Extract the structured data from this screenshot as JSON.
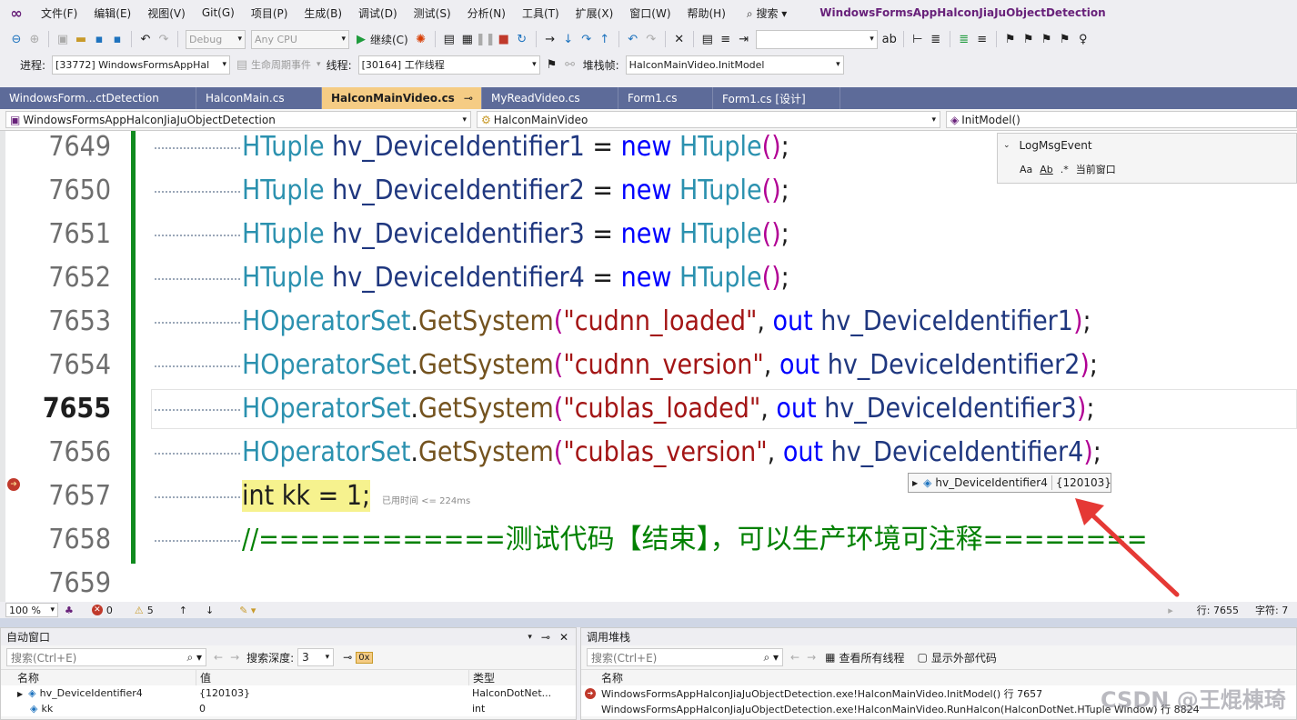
{
  "menubar": {
    "logo": "VS",
    "items": [
      "文件(F)",
      "编辑(E)",
      "视图(V)",
      "Git(G)",
      "项目(P)",
      "生成(B)",
      "调试(D)",
      "测试(S)",
      "分析(N)",
      "工具(T)",
      "扩展(X)",
      "窗口(W)",
      "帮助(H)"
    ],
    "search": "搜索",
    "title": "WindowsFormsAppHalconJiaJuObjectDetection"
  },
  "toolbar1": {
    "config": "Debug",
    "platform": "Any CPU",
    "continue": "继续(C)"
  },
  "toolbar2": {
    "process_label": "进程:",
    "process_value": "[33772] WindowsFormsAppHal",
    "lifecycle": "生命周期事件",
    "thread_label": "线程:",
    "thread_value": "[30164] 工作线程",
    "stackframe_label": "堆栈帧:",
    "stackframe_value": "HalconMainVideo.InitModel"
  },
  "tabs": [
    "WindowsForm...ctDetection",
    "HalconMain.cs",
    "HalconMainVideo.cs",
    "MyReadVideo.cs",
    "Form1.cs",
    "Form1.cs [设计]"
  ],
  "navbar": {
    "project": "WindowsFormsAppHalconJiaJuObjectDetection",
    "class": "HalconMainVideo",
    "member": "InitModel()"
  },
  "editor": {
    "lines": [
      "7649",
      "7650",
      "7651",
      "7652",
      "7653",
      "7654",
      "7655",
      "7656",
      "7657",
      "7658",
      "7659"
    ],
    "current_line": "7655",
    "code": {
      "l7649": [
        "HTuple",
        "hv_DeviceIdentifier1",
        "=",
        "new",
        "HTuple",
        "()",
        ";"
      ],
      "l7650": [
        "HTuple",
        "hv_DeviceIdentifier2",
        "=",
        "new",
        "HTuple",
        "()",
        ";"
      ],
      "l7651": [
        "HTuple",
        "hv_DeviceIdentifier3",
        "=",
        "new",
        "HTuple",
        "()",
        ";"
      ],
      "l7652": [
        "HTuple",
        "hv_DeviceIdentifier4",
        "=",
        "new",
        "HTuple",
        "()",
        ";"
      ],
      "l7653": [
        "HOperatorSet",
        ".",
        "GetSystem",
        "(",
        "\"cudnn_loaded\"",
        ",",
        "out",
        "hv_DeviceIdentifier1",
        ")",
        ";"
      ],
      "l7654": [
        "HOperatorSet",
        ".",
        "GetSystem",
        "(",
        "\"cudnn_version\"",
        ",",
        "out",
        "hv_DeviceIdentifier2",
        ")",
        ";"
      ],
      "l7655": [
        "HOperatorSet",
        ".",
        "GetSystem",
        "(",
        "\"cublas_loaded\"",
        ",",
        "out",
        "hv_DeviceIdentifier3",
        ")",
        ";"
      ],
      "l7656": [
        "HOperatorSet",
        ".",
        "GetSystem",
        "(",
        "\"cublas_version\"",
        ",",
        "out",
        "hv_DeviceIdentifier4",
        ")",
        ";"
      ],
      "l7657": [
        "int",
        "kk",
        "=",
        "1",
        ";"
      ],
      "l7658": "//============测试代码【结束】，可以生产环境可注释========"
    },
    "elapsed": "已用时间 <= 224ms",
    "logmsg": {
      "text": "LogMsgEvent",
      "scope": "当前窗口"
    },
    "datatip": {
      "name": "hv_DeviceIdentifier4",
      "value": "{120103}"
    }
  },
  "statusstrip": {
    "zoom": "100 %",
    "errors": "0",
    "warnings": "5",
    "line": "行: 7655",
    "col": "字符: 7"
  },
  "autos": {
    "title": "自动窗口",
    "search_placeholder": "搜索(Ctrl+E)",
    "depth_label": "搜索深度:",
    "depth_value": "3",
    "columns": [
      "名称",
      "值",
      "类型"
    ],
    "rows": [
      {
        "name": "hv_DeviceIdentifier4",
        "value": "{120103}",
        "type": "HalconDotNet..."
      },
      {
        "name": "kk",
        "value": "0",
        "type": "int"
      }
    ]
  },
  "callstack": {
    "title": "调用堆栈",
    "search_placeholder": "搜索(Ctrl+E)",
    "show_threads": "查看所有线程",
    "show_external": "显示外部代码",
    "column": "名称",
    "rows": [
      "WindowsFormsAppHalconJiaJuObjectDetection.exe!HalconMainVideo.InitModel() 行 7657",
      "WindowsFormsAppHalconJiaJuObjectDetection.exe!HalconMainVideo.RunHalcon(HalconDotNet.HTuple Window) 行 8824"
    ]
  },
  "watermark": "CSDN @王焜棟琦",
  "colors": {
    "accent": "#68217a",
    "tab_active": "#f5cc84",
    "tab_bar": "#5d6b99",
    "green_bar": "#108a1e",
    "highlight": "#f6f28e"
  }
}
